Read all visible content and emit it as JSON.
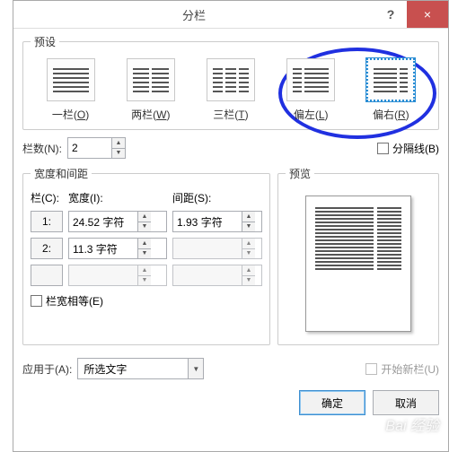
{
  "dialog": {
    "title": "分栏",
    "help_tooltip": "?",
    "close_tooltip": "×"
  },
  "presets": {
    "legend": "预设",
    "items": [
      {
        "label": "一栏(",
        "key": "O",
        "tail": ")"
      },
      {
        "label": "两栏(",
        "key": "W",
        "tail": ")"
      },
      {
        "label": "三栏(",
        "key": "T",
        "tail": ")"
      },
      {
        "label": "偏左(",
        "key": "L",
        "tail": ")"
      },
      {
        "label": "偏右(",
        "key": "R",
        "tail": ")"
      }
    ]
  },
  "count": {
    "label": "栏数(N):",
    "value": "2"
  },
  "separator": {
    "label": "分隔线(B)",
    "checked": false
  },
  "widths": {
    "legend": "宽度和间距",
    "col_label": "栏(C):",
    "width_label": "宽度(I):",
    "spacing_label": "间距(S):",
    "rows": [
      {
        "index": "1:",
        "width": "24.52 字符",
        "spacing": "1.93 字符"
      },
      {
        "index": "2:",
        "width": "11.3 字符",
        "spacing": ""
      },
      {
        "index": "",
        "width": "",
        "spacing": ""
      }
    ],
    "equal": {
      "label": "栏宽相等(E)",
      "checked": false
    }
  },
  "preview": {
    "legend": "预览"
  },
  "applyto": {
    "label": "应用于(A):",
    "value": "所选文字"
  },
  "newcol": {
    "label": "开始新栏(U)",
    "enabled": false
  },
  "buttons": {
    "ok": "确定",
    "cancel": "取消"
  },
  "watermark": "Bai 经验"
}
